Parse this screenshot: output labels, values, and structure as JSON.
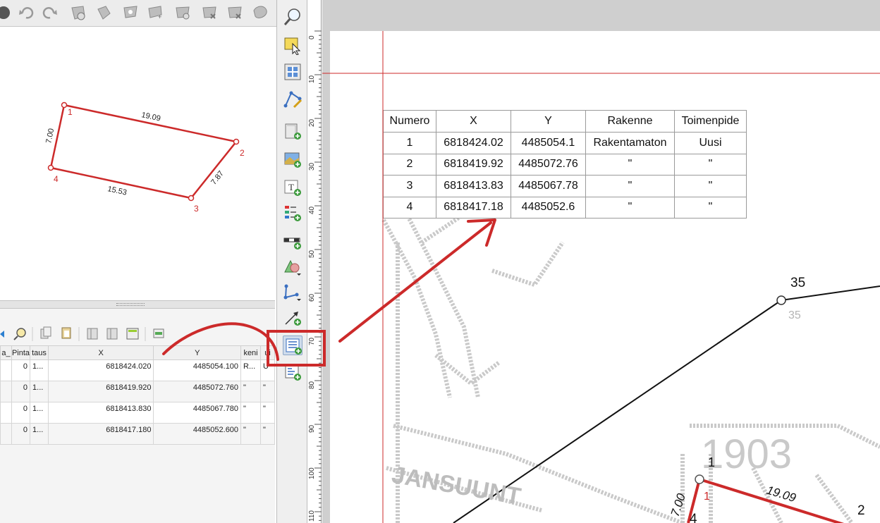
{
  "map": {
    "vertex_labels": [
      "1",
      "2",
      "3",
      "4"
    ],
    "edge_labels": [
      "19.09",
      "7.87",
      "15.53",
      "7.00"
    ]
  },
  "attribute_table": {
    "headers": [
      "a_",
      "Pinta",
      "taus",
      "X",
      "Y",
      "keni",
      "ui"
    ],
    "rows": [
      {
        "a": "",
        "pinta": "0",
        "taus": "1...",
        "x": "6818424.020",
        "y": "4485054.100",
        "keni": "R...",
        "ui": "U"
      },
      {
        "a": "",
        "pinta": "0",
        "taus": "1...",
        "x": "6818419.920",
        "y": "4485072.760",
        "keni": "\"",
        "ui": "\""
      },
      {
        "a": "",
        "pinta": "0",
        "taus": "1...",
        "x": "6818413.830",
        "y": "4485067.780",
        "keni": "\"",
        "ui": "\""
      },
      {
        "a": "",
        "pinta": "0",
        "taus": "1...",
        "x": "6818417.180",
        "y": "4485052.600",
        "keni": "\"",
        "ui": "\""
      }
    ]
  },
  "ruler": {
    "labels": [
      "0",
      "10",
      "20",
      "30",
      "40",
      "50",
      "60",
      "70",
      "80",
      "90",
      "100",
      "110"
    ]
  },
  "composer_table": {
    "headers": [
      "Numero",
      "X",
      "Y",
      "Rakenne",
      "Toimenpide"
    ],
    "rows": [
      [
        "1",
        "6818424.02",
        "4485054.1",
        "Rakentamaton",
        "Uusi"
      ],
      [
        "2",
        "6818419.92",
        "4485072.76",
        "\"",
        "\""
      ],
      [
        "3",
        "6818413.83",
        "4485067.78",
        "\"",
        "\""
      ],
      [
        "4",
        "6818417.18",
        "4485052.6",
        "\"",
        "\""
      ]
    ]
  },
  "composer_map": {
    "point_35_label": "35",
    "point_35_ghost": "35",
    "year_label": "1903",
    "street_label": "JANSUUNT",
    "vertex_1_label": "1",
    "vertex_1_ghost": "1",
    "vertex_2_label": "2",
    "vertex_4_label": "4",
    "edge_1_2": "19.09",
    "edge_1_4": "7.00"
  },
  "colors": {
    "parcel": "#cc2a2a",
    "annotation": "#cc2a2a",
    "margin_line": "#cc2a2a"
  }
}
